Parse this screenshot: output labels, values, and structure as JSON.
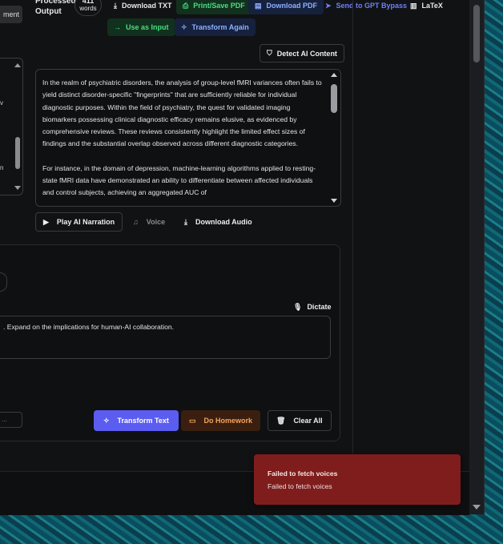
{
  "header": {
    "left_tab_label": "ment",
    "output_label_line1": "Processed",
    "output_label_line2": "Output",
    "word_count": "411",
    "word_count_unit": "words"
  },
  "toolbar": {
    "download_txt": "Download TXT",
    "print_save_pdf": "Print/Save PDF",
    "download_pdf": "Download PDF",
    "send_to_gpt_bypass": "Send to GPT Bypass",
    "latex": "LaTeX",
    "use_as_input": "Use as Input",
    "transform_again": "Transform Again",
    "detect_ai_content": "Detect AI Content"
  },
  "left_fragments": [
    "v",
    "n"
  ],
  "output_text": {
    "para1": "In the realm of psychiatric disorders, the analysis of group-level fMRI variances often fails to yield distinct disorder-specific \"fingerprints\" that are sufficiently reliable for individual diagnostic purposes. Within the field of psychiatry, the quest for validated imaging biomarkers possessing clinical diagnostic efficacy remains elusive, as evidenced by comprehensive reviews. These reviews consistently highlight the limited effect sizes of findings and the substantial overlap observed across different diagnostic categories.",
    "para2": "For instance, in the domain of depression, machine-learning algorithms applied to resting-state fMRI data have demonstrated an ability to differentiate between affected individuals and control subjects, achieving an aggregated AUC of"
  },
  "audio": {
    "play_narration": "Play AI Narration",
    "voice": "Voice",
    "download_audio": "Download Audio"
  },
  "input": {
    "dictate": "Dictate",
    "prompt_text": ". Expand on the implications for human-AI collaboration.",
    "select_fragment": "..."
  },
  "actions": {
    "transform_text": "Transform Text",
    "do_homework": "Do Homework",
    "clear_all": "Clear All"
  },
  "toast": {
    "title": "Failed to fetch voices",
    "message": "Failed to fetch voices"
  },
  "colors": {
    "accent_blue": "#5b5cf0",
    "toast_red": "#7f1d1d",
    "green_text": "#4ade80",
    "blue_text": "#7fa5ff"
  }
}
